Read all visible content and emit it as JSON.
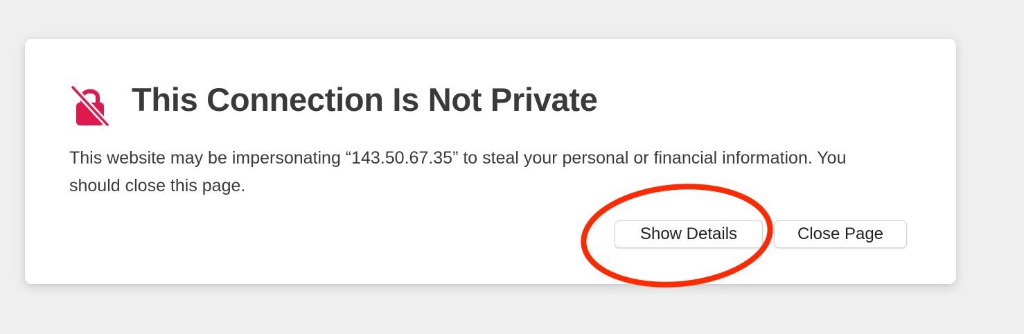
{
  "dialog": {
    "title": "This Connection Is Not Private",
    "message": "This website may be impersonating “143.50.67.35” to steal your personal or financial information. You should close this page.",
    "show_details_label": "Show Details",
    "close_page_label": "Close Page",
    "icon": "lock-slash-icon"
  },
  "colors": {
    "accent": "#e0184d",
    "annotation": "#ff2a00",
    "title_text": "#3a3a3a",
    "page_background": "#efefef"
  }
}
